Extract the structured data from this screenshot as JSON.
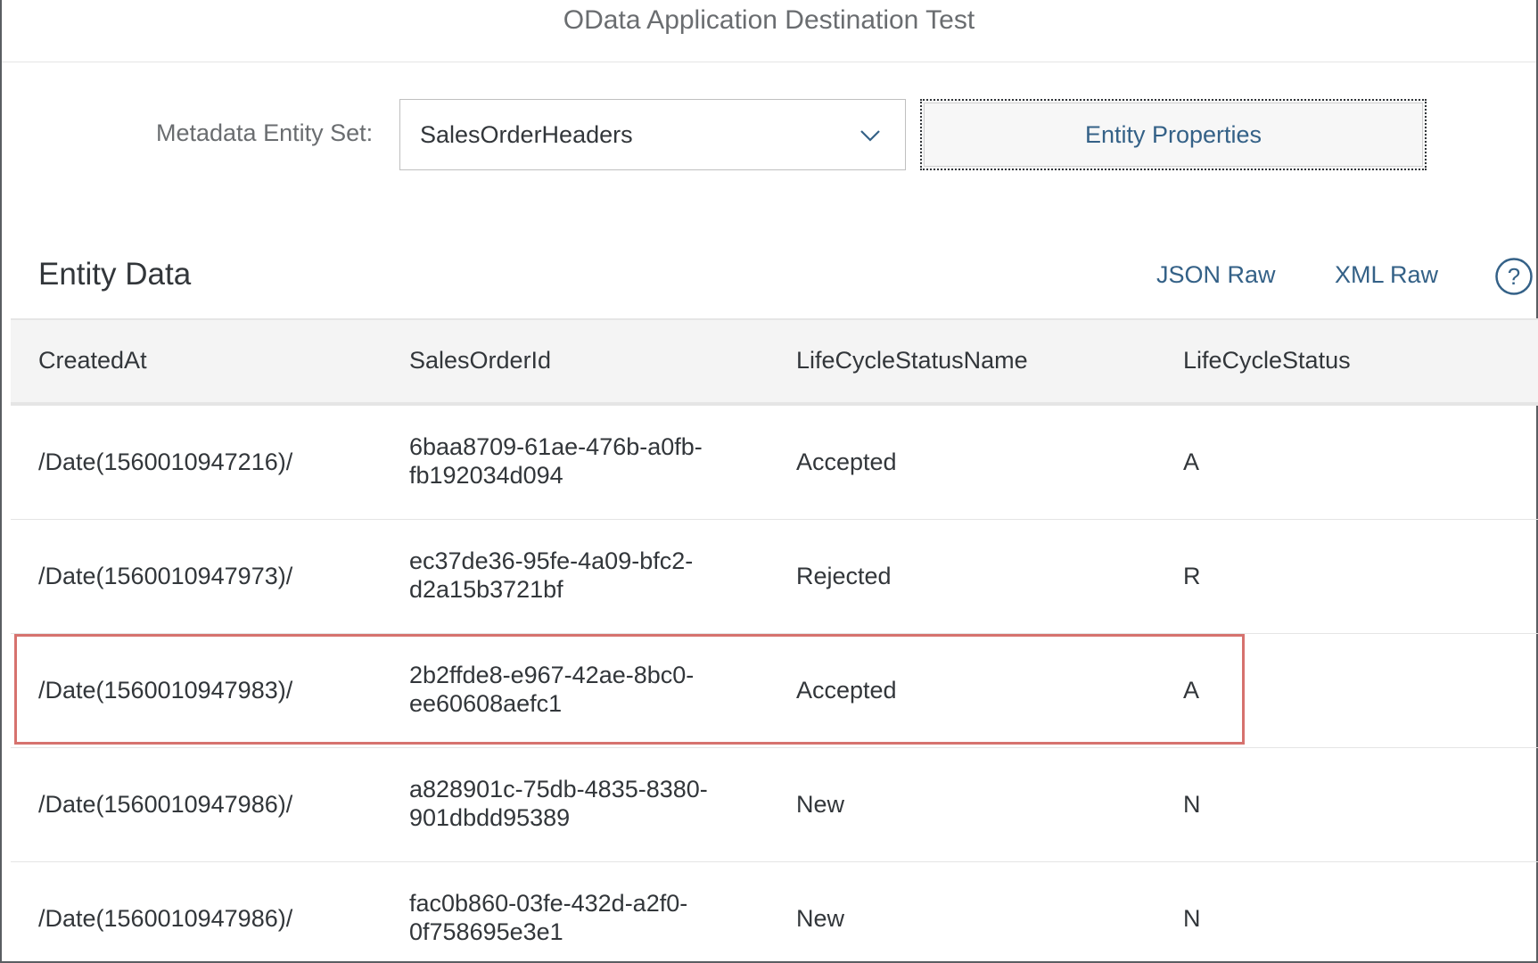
{
  "header": {
    "title": "OData Application Destination Test"
  },
  "metadata": {
    "label": "Metadata Entity Set:",
    "selected": "SalesOrderHeaders",
    "button_label": "Entity Properties"
  },
  "entity_section": {
    "title": "Entity Data",
    "json_raw": "JSON Raw",
    "xml_raw": "XML Raw",
    "help_icon": "help-circle-icon"
  },
  "table": {
    "columns": [
      "CreatedAt",
      "SalesOrderId",
      "LifeCycleStatusName",
      "LifeCycleStatus"
    ],
    "rows": [
      {
        "created": "/Date(1560010947216)/",
        "id_line1": "6baa8709-61ae-476b-a0fb-",
        "id_line2": "fb192034d094",
        "status_name": "Accepted",
        "status": "A"
      },
      {
        "created": "/Date(1560010947973)/",
        "id_line1": "ec37de36-95fe-4a09-bfc2-",
        "id_line2": "d2a15b3721bf",
        "status_name": "Rejected",
        "status": "R"
      },
      {
        "created": "/Date(1560010947983)/",
        "id_line1": "2b2ffde8-e967-42ae-8bc0-",
        "id_line2": "ee60608aefc1",
        "status_name": "Accepted",
        "status": "A"
      },
      {
        "created": "/Date(1560010947986)/",
        "id_line1": "a828901c-75db-4835-8380-",
        "id_line2": "901dbdd95389",
        "status_name": "New",
        "status": "N"
      },
      {
        "created": "/Date(1560010947986)/",
        "id_line1": "fac0b860-03fe-432d-a2f0-",
        "id_line2": "0f758695e3e1",
        "status_name": "New",
        "status": "N"
      }
    ]
  },
  "colors": {
    "link": "#346187",
    "highlight": "#d6726e",
    "header_bg": "#f4f4f4"
  }
}
